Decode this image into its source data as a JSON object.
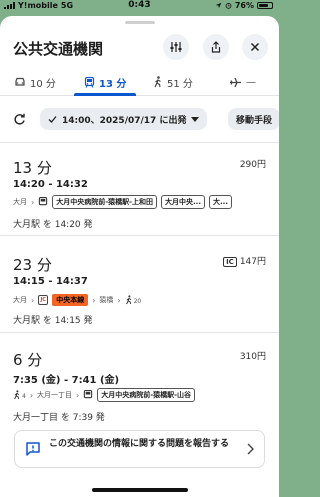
{
  "status_bar": {
    "carrier": "Y!mobile",
    "network": "5G",
    "time": "0:43",
    "battery": "76%",
    "battery_level": 0.76
  },
  "header": {
    "title": "公共交通機関"
  },
  "tabs": [
    {
      "label": "10 分",
      "icon": "car-icon"
    },
    {
      "label": "13 分",
      "icon": "bus-icon",
      "active": true
    },
    {
      "label": "51 分",
      "icon": "walk-icon"
    },
    {
      "label": "—",
      "icon": "flight-icon"
    }
  ],
  "filters": {
    "depart_chip": "14:00、2025/07/17 に出発",
    "mode_chip": "移動手段"
  },
  "routes": [
    {
      "duration": "13 分",
      "fare": "290円",
      "times": "14:20 - 14:32",
      "steps": {
        "origin": "大月",
        "stop1": "大月中央病院前-猿橋駅-上和田",
        "stop2": "大月中央...",
        "stop3": "大..."
      },
      "departure": "大月駅 を 14:20 発"
    },
    {
      "duration": "23 分",
      "fare_ic": "IC",
      "fare": "147円",
      "times": "14:15 - 14:37",
      "steps": {
        "origin": "大月",
        "jc": "JC",
        "line": "中央本線",
        "dest": "猿橋",
        "walk": "20"
      },
      "departure": "大月駅 を 14:15 発"
    },
    {
      "duration": "6 分",
      "fare": "310円",
      "times": "7:35 (金) - 7:41 (金)",
      "steps": {
        "walk": "4",
        "stop": "大月一丁目",
        "bus": "大月中央病院前-猿橋駅-山谷"
      },
      "departure": "大月一丁目 を 7:39 発"
    }
  ],
  "report": {
    "text": "この交通機関の情報に関する問題を報告する"
  },
  "colors": {
    "accent": "#0b57d0",
    "chuo_line": "#f26522",
    "map_bg": "#7fb08a"
  }
}
